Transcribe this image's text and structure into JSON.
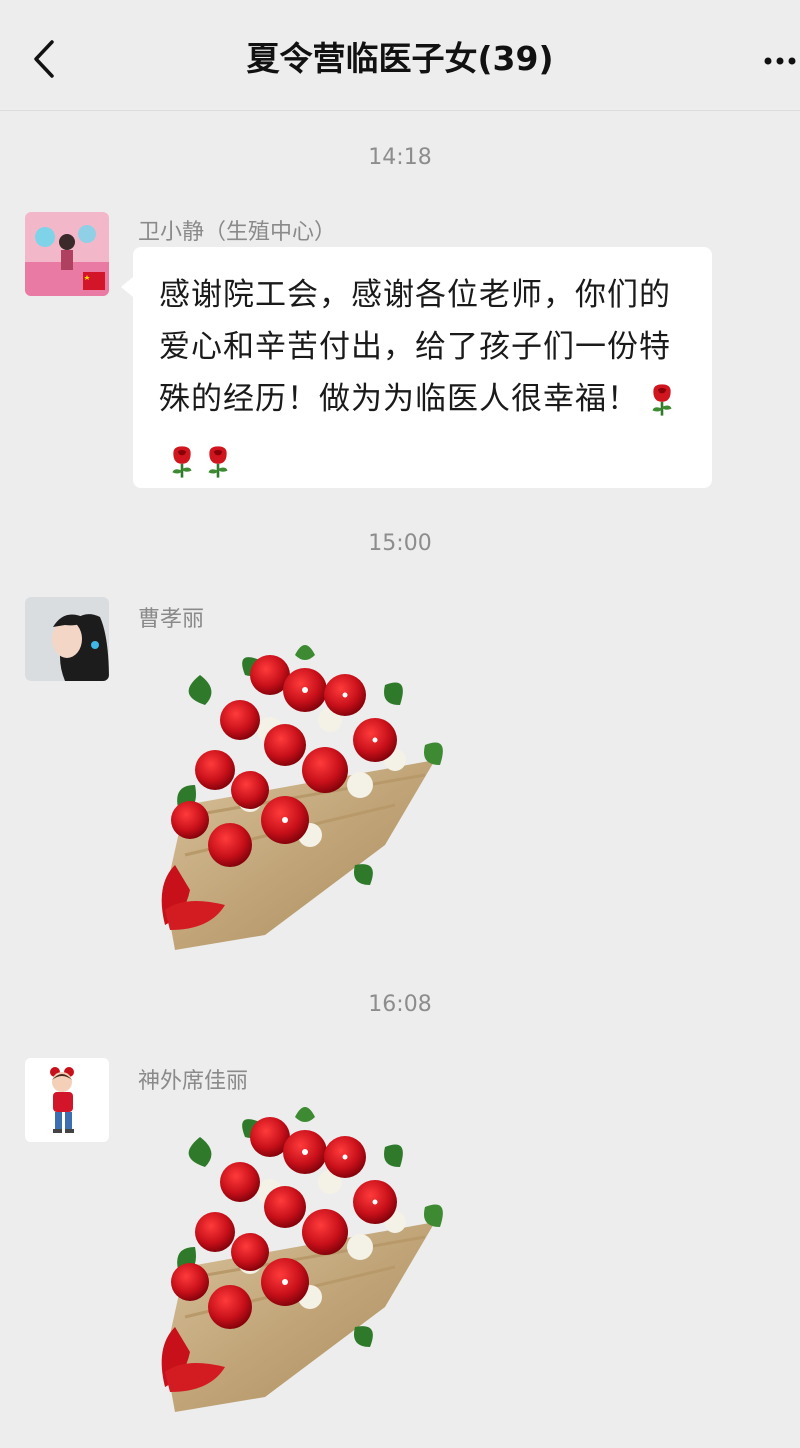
{
  "header": {
    "title": "夏令营临医子女(39)"
  },
  "messages": [
    {
      "time": "14:18",
      "sender": "卫小静（生殖中心）",
      "text": "感谢院工会，感谢各位老师，你们的爱心和辛苦付出，给了孩子们一份特殊的经历！做为为临医人很幸福！",
      "emoji": [
        "rose-icon",
        "rose-icon",
        "rose-icon"
      ]
    },
    {
      "time": "15:00",
      "sender": "曹孝丽",
      "sticker": "rose-bouquet-sticker"
    },
    {
      "time": "16:08",
      "sender": "神外席佳丽",
      "sticker": "rose-bouquet-sticker"
    }
  ],
  "colors": {
    "background": "#ededed",
    "bubble": "#ffffff",
    "rose_red": "#c8101a",
    "leaf_green": "#2f7a2a",
    "wrap": "#c4a77a"
  }
}
